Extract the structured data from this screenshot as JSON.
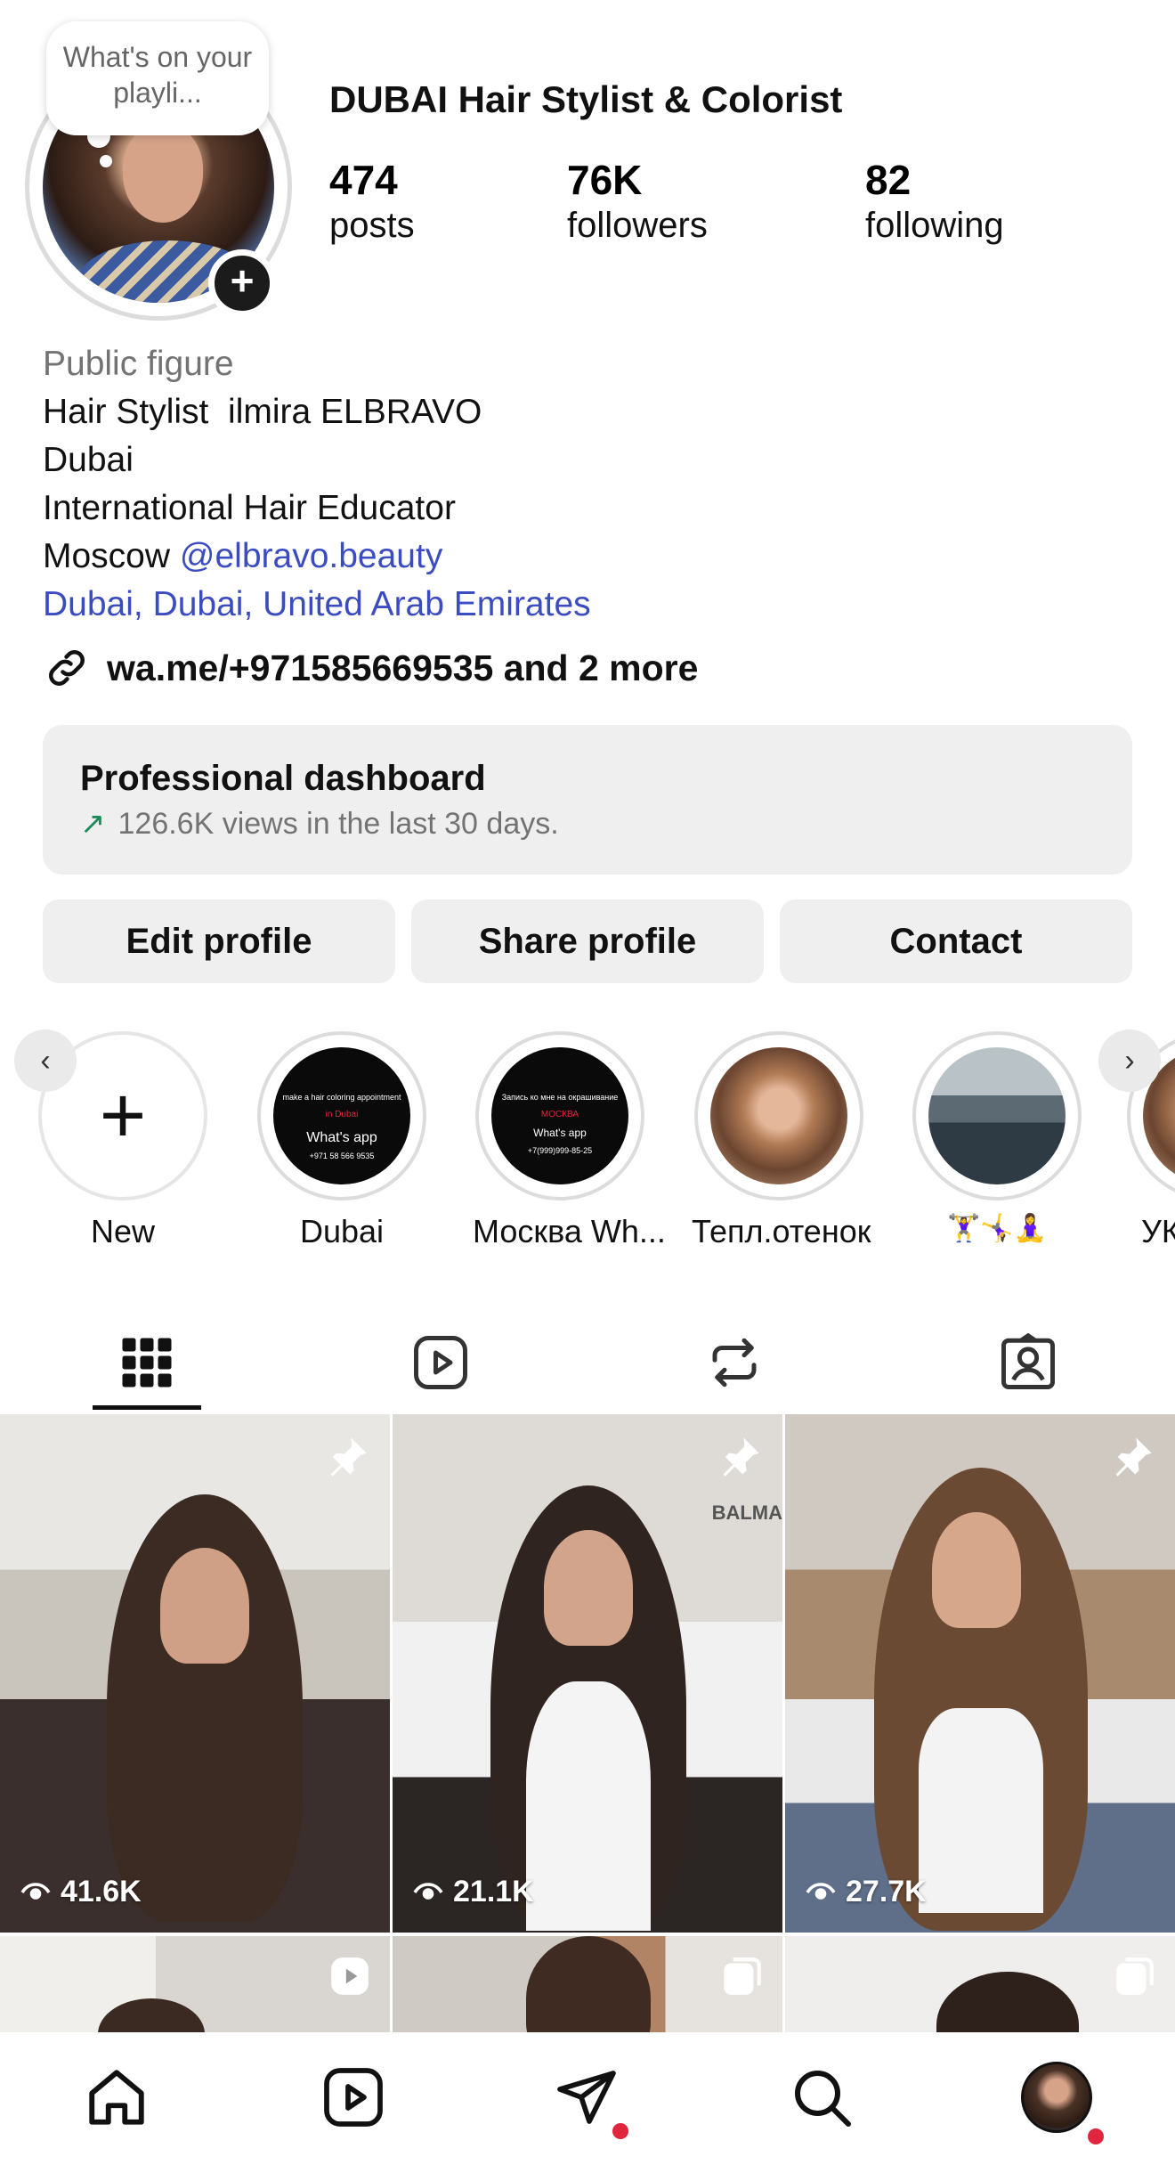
{
  "note": {
    "text": "What's on your playli..."
  },
  "profile": {
    "name": "DUBAI Hair Stylist & Colorist",
    "stats": [
      {
        "value": "474",
        "label": "posts"
      },
      {
        "value": "76K",
        "label": "followers"
      },
      {
        "value": "82",
        "label": "following"
      }
    ]
  },
  "bio": {
    "category": "Public figure",
    "line1": "Hair Stylist  ilmira ELBRAVO",
    "line2": "Dubai",
    "line3": "International Hair Educator",
    "line4_prefix": "Moscow",
    "mention": "@elbravo.beauty",
    "location": "Dubai, Dubai, United Arab Emirates",
    "link": "wa.me/+971585669535 and 2 more"
  },
  "dashboard": {
    "title": "Professional dashboard",
    "subtitle": "126.6K views in the last 30 days."
  },
  "buttons": {
    "edit": "Edit profile",
    "share": "Share profile",
    "contact": "Contact"
  },
  "highlights": [
    {
      "label": "New"
    },
    {
      "label": "Dubai",
      "cover_lines": [
        "make a hair coloring appointment",
        "in Dubai",
        "What's app",
        "+971 58 566 9535"
      ]
    },
    {
      "label": "Москва Wh...",
      "cover_lines": [
        "Запись ко мне на окрашивание",
        "МОСКВА",
        "What's app",
        "+7(999)999-85-25"
      ]
    },
    {
      "label": "Тепл.отенок"
    },
    {
      "label": "🏋️‍♀️🤸‍♀️🧘‍♀️"
    },
    {
      "label": "УК"
    }
  ],
  "tabs": [
    "grid-icon",
    "reels-icon",
    "reposts-icon",
    "tagged-icon"
  ],
  "posts": [
    {
      "views": "41.6K",
      "badge": "pin-icon"
    },
    {
      "views": "21.1K",
      "badge": "pin-icon",
      "brand": "BALMA"
    },
    {
      "views": "27.7K",
      "badge": "pin-icon"
    },
    {
      "badge": "reel-icon"
    },
    {
      "badge": "carousel-icon"
    },
    {
      "badge": "carousel-icon"
    }
  ],
  "bottom_nav": [
    "home-icon",
    "reels-icon",
    "direct-messages-icon",
    "search-icon",
    "profile-avatar"
  ],
  "colors": {
    "link_blue": "#3b4cc0",
    "trend_green": "#1c8c5c",
    "notification_red": "#e0263d",
    "button_gray": "#efefef"
  }
}
